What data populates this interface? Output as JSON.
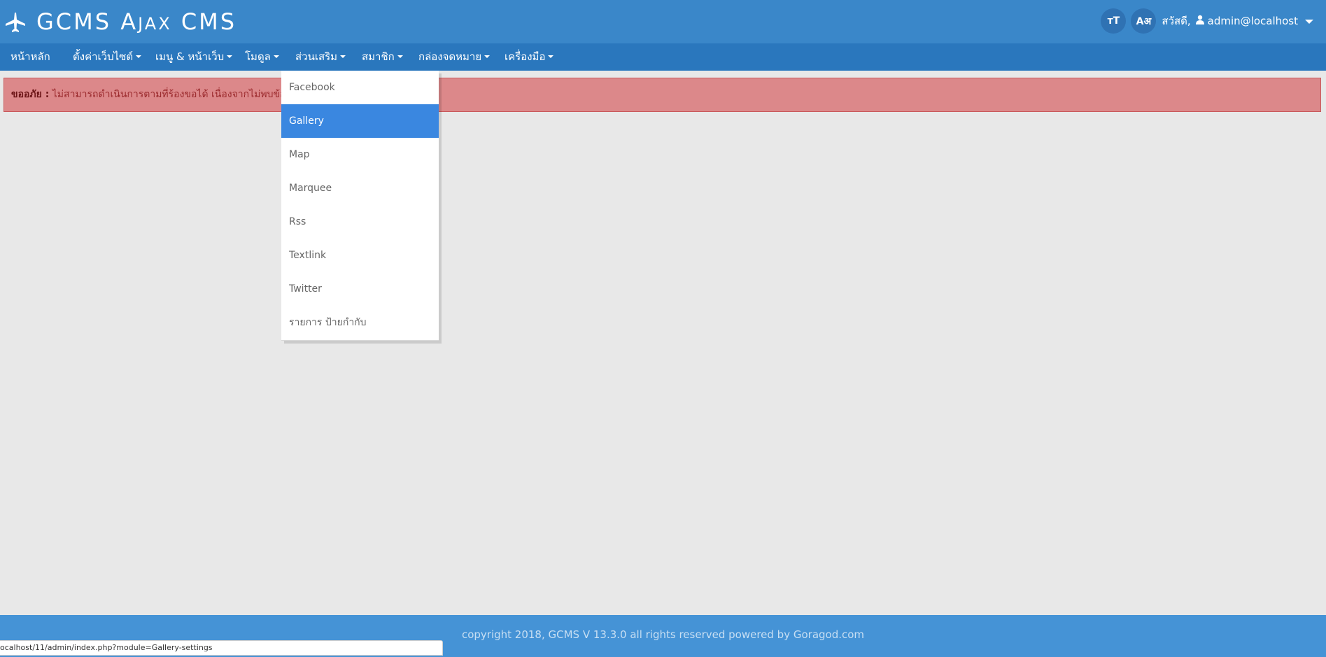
{
  "app": {
    "brand_main": "GCMS A",
    "brand_small": "JAX",
    "brand_end": " CMS",
    "brand_icon": "airplane-icon"
  },
  "topright": {
    "font_size_btn": "ᴛT",
    "language_btn": "Aअ",
    "greeting": "สวัสดี,",
    "user": "admin@localhost"
  },
  "nav": {
    "items": [
      {
        "label": "หน้าหลัก",
        "has_caret": false
      },
      {
        "label": "ตั้งค่าเว็บไซต์",
        "has_caret": true
      },
      {
        "label": "เมนู & หน้าเว็บ",
        "has_caret": true
      },
      {
        "label": "โมดูล",
        "has_caret": true
      },
      {
        "label": "ส่วนเสริม",
        "has_caret": true
      },
      {
        "label": "สมาชิก",
        "has_caret": true
      },
      {
        "label": "กล่องจดหมาย",
        "has_caret": true
      },
      {
        "label": "เครื่องมือ",
        "has_caret": true
      }
    ]
  },
  "alert": {
    "title": "ขออภัย :",
    "message": "ไม่สามารถดำเนินการตามที่ร้องขอได้ เนื่องจากไม่พบข้อมูล"
  },
  "dropdown": {
    "items": [
      {
        "label": "Facebook",
        "selected": false
      },
      {
        "label": "Gallery",
        "selected": true
      },
      {
        "label": "Map",
        "selected": false
      },
      {
        "label": "Marquee",
        "selected": false
      },
      {
        "label": "Rss",
        "selected": false
      },
      {
        "label": "Textlink",
        "selected": false
      },
      {
        "label": "Twitter",
        "selected": false
      },
      {
        "label": "รายการ ป้ายกำกับ",
        "selected": false
      }
    ]
  },
  "footer": {
    "text": "copyright 2018, GCMS V 13.3.0 all rights reserved powered by Goragod.com"
  },
  "status_url": "ocalhost/11/admin/index.php?module=Gallery-settings",
  "colors": {
    "topbar": "#3a87c9",
    "navbar": "#2a77bd",
    "alert_bg": "#dc888a",
    "selected": "#3a87e0",
    "footer": "#4593d6"
  }
}
